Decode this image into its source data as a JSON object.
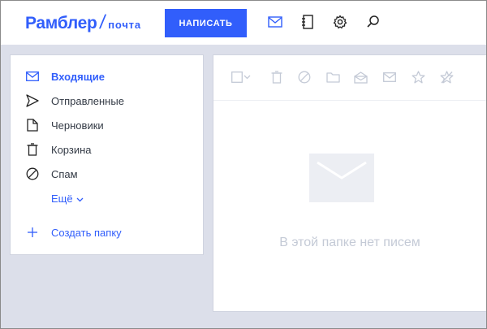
{
  "app": {
    "logo_main": "Рамблер",
    "logo_slash": "/",
    "logo_sub": "почта"
  },
  "header": {
    "compose_label": "НАПИСАТЬ",
    "icons": [
      "mail-icon",
      "contacts-icon",
      "gear-icon",
      "search-icon"
    ]
  },
  "sidebar": {
    "folders": [
      {
        "label": "Входящие",
        "icon": "inbox-icon",
        "active": true
      },
      {
        "label": "Отправленные",
        "icon": "sent-icon",
        "active": false
      },
      {
        "label": "Черновики",
        "icon": "drafts-icon",
        "active": false
      },
      {
        "label": "Корзина",
        "icon": "trash-icon",
        "active": false
      },
      {
        "label": "Спам",
        "icon": "spam-icon",
        "active": false
      }
    ],
    "more_label": "Ещё",
    "create_folder_label": "Создать папку"
  },
  "main": {
    "toolbar_icons": [
      "select-all-checkbox",
      "chevron-down-icon",
      "delete-icon",
      "spam-icon",
      "move-to-folder-icon",
      "mark-read-icon",
      "mark-unread-icon",
      "star-icon",
      "unstar-icon"
    ],
    "empty_message": "В этой папке нет писем"
  },
  "colors": {
    "accent": "#315efb",
    "content_bg": "#dcdfea",
    "muted_icon": "#c4cad6",
    "text": "#333a45"
  }
}
